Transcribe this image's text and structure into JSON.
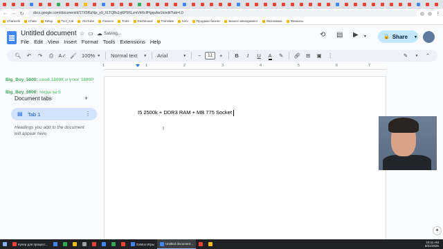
{
  "browser": {
    "tab_favicon_colors": [
      "#ea4335",
      "#ea4335",
      "#ea4335",
      "#4285f4",
      "#ea4335",
      "#ea4335",
      "#34a853",
      "#ea4335",
      "#ea4335",
      "#fbbc04",
      "#ea4335",
      "#4285f4",
      "#ea4335",
      "#ea4335",
      "#ea4335",
      "#34a853",
      "#ea4335",
      "#ea4335",
      "#ea4335",
      "#ea4335",
      "#4285f4",
      "#ea4335",
      "#ea4335",
      "#ea4335",
      "#ea4335",
      "#ea4335",
      "#4285f4",
      "#ea4335",
      "#ea4335",
      "#ea4335",
      "#ea4335",
      "#ea4335",
      "#ea4335",
      "#ea4335",
      "#ea4335",
      "#ea4335",
      "#ea4335",
      "#4285f4",
      "#ea4335",
      "#ea4335",
      "#ea4335",
      "#ea4335",
      "#ea4335",
      "#ea4335",
      "#ea4335",
      "#ea4335",
      "#4285f4",
      "#ea4335",
      "#ea4335",
      "#ea4335",
      "#ea4335",
      "#ea4335",
      "#ea4335",
      "#ea4335",
      "#ea4335",
      "#ea4335",
      "#ea4335",
      "#ea4335",
      "#ea4335",
      "#ea4335",
      "#ea4335",
      "#ea4335",
      "#ea4335",
      "#4285f4"
    ],
    "window_controls": [
      "–",
      "□",
      "✕"
    ],
    "url": "docs.google.com/document/d/1TX5f6zNjx_y9_XLTQBs1yj6P5RLzmVhRcIfHgqsAw1k/edit?tab=t.0",
    "bookmarks": [
      "Channels",
      "Chats",
      "Setup",
      "Tool_Cat",
      "YouTube",
      "Finance",
      "Tools",
      "Dashboard",
      "Translate",
      "Kiev",
      "Продажи бизнес",
      "Бизнес менеджмент",
      "Экономика",
      "Финансы"
    ]
  },
  "doc": {
    "title": "Untitled document",
    "saving_text": "Saving...",
    "menu": [
      "File",
      "Edit",
      "View",
      "Insert",
      "Format",
      "Tools",
      "Extensions",
      "Help"
    ],
    "share_label": "Share",
    "toolbar": {
      "zoom": "100%",
      "style": "Normal text",
      "font": "Arial",
      "font_size": "11"
    },
    "ruler_numbers": [
      "1",
      "1",
      "2",
      "3",
      "4",
      "5",
      "6",
      "7"
    ],
    "body_text": "I5 2500k + DDR3 RAM + MB 775 Socket"
  },
  "sidebar": {
    "heading": "Document tabs",
    "tab_label": "Tab 1",
    "hint": "Headings you add to the document will appear here."
  },
  "chat": [
    {
      "user": "Big_Boy_5000:",
      "message": "свой 1800К и утюг 1800Р"
    },
    {
      "user": "Big_Boy_5000:",
      "message": "тогда за 5"
    }
  ],
  "taskbar": {
    "items": [
      {
        "label": "Купер для процесс...",
        "color": "#ea4335"
      },
      {
        "label": "",
        "color": "#4285f4"
      },
      {
        "label": "",
        "color": "#34a853"
      },
      {
        "label": "",
        "color": "#fbbc04"
      },
      {
        "label": "",
        "color": "#9aa0a6"
      },
      {
        "label": "",
        "color": "#ea4335"
      },
      {
        "label": "",
        "color": "#4285f4"
      },
      {
        "label": "",
        "color": "#34a853"
      },
      {
        "label": "",
        "color": "#ea4335"
      },
      {
        "label": "ExMox Игры",
        "color": "#4285f4"
      },
      {
        "label": "Untitled document...",
        "color": "#4285f4",
        "active": true
      },
      {
        "label": "",
        "color": "#ea4335"
      },
      {
        "label": "",
        "color": "#fbbc04"
      }
    ],
    "time": "10:11 AM",
    "date": "8/21/2025"
  }
}
